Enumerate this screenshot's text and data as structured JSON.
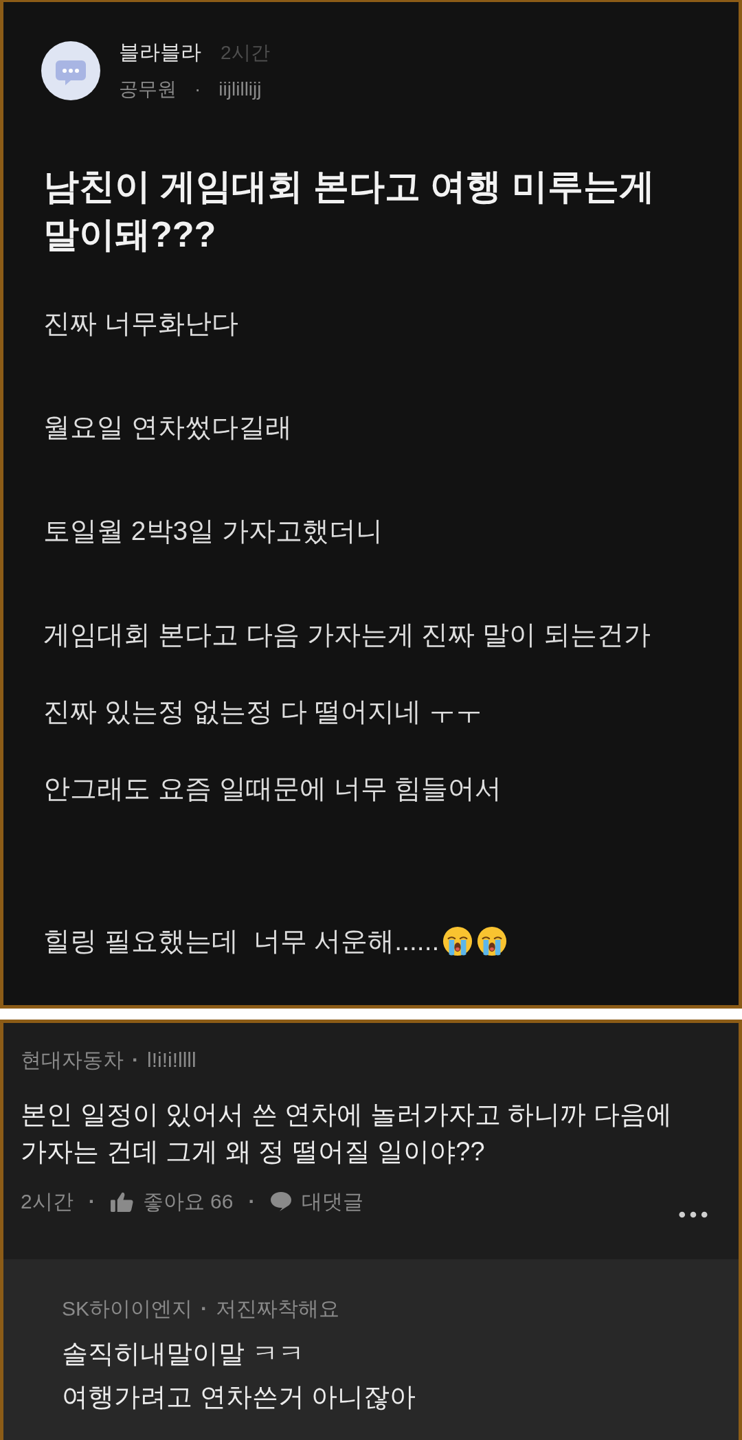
{
  "post": {
    "author": {
      "name": "블라블라",
      "time": "2시간",
      "company": "공무원",
      "separator": "·",
      "nickname": "iijlillijj"
    },
    "title": "남친이 게임대회 본다고 여행 미루는게 말이돼???",
    "paragraphs": [
      {
        "text": "진짜 너무화난다"
      },
      {
        "text": "월요일 연차썼다길래"
      },
      {
        "text": "토일월 2박3일 가자고했더니"
      },
      {
        "text": "게임대회 본다고 다음 가자는게 진짜 말이 되는건가"
      },
      {
        "text": "진짜 있는정 없는정 다 떨어지네 ㅜㅜ"
      },
      {
        "text": "안그래도 요즘 일때문에 너무 힘들어서"
      },
      {
        "text": "힐링 필요했는데  너무 서운해......",
        "icons": [
          {
            "kind": "crying_face"
          },
          {
            "kind": "crying_face"
          }
        ]
      }
    ]
  },
  "comment": {
    "company": "현대자동차",
    "separator": "·",
    "nickname": "l!i!i!llll",
    "text": "본인 일정이 있어서 쓴 연차에 놀러가자고 하니까 다음에 가자는 건데 그게 왜 정 떨어질 일이야??",
    "footer": [
      {
        "kind": "time",
        "text": "2시간"
      },
      {
        "kind": "separator",
        "text": "·"
      },
      {
        "kind": "like",
        "text": "좋아요 66"
      },
      {
        "kind": "separator",
        "text": "·"
      },
      {
        "kind": "reply",
        "text": "대댓글"
      }
    ]
  },
  "reply": {
    "company": "SK하이이엔지",
    "separator": "·",
    "nickname": "저진짜착해요",
    "lines": [
      "솔직히내말이말 ㅋㅋ",
      "여행가려고 연차쓴거 아니잖아"
    ]
  }
}
